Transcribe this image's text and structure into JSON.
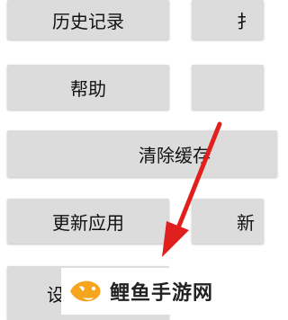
{
  "buttons": {
    "history": "历史记录",
    "top_right": "扌",
    "help": "帮助",
    "clear_cache": "清除缓存",
    "update_app": "更新应用",
    "row4_right": "新",
    "settings": "设"
  },
  "watermark": {
    "text": "鲤鱼手游网"
  },
  "colors": {
    "button_bg": "#dcdcdc",
    "arrow": "#e0201c",
    "logo_orange": "#f5a51e"
  }
}
